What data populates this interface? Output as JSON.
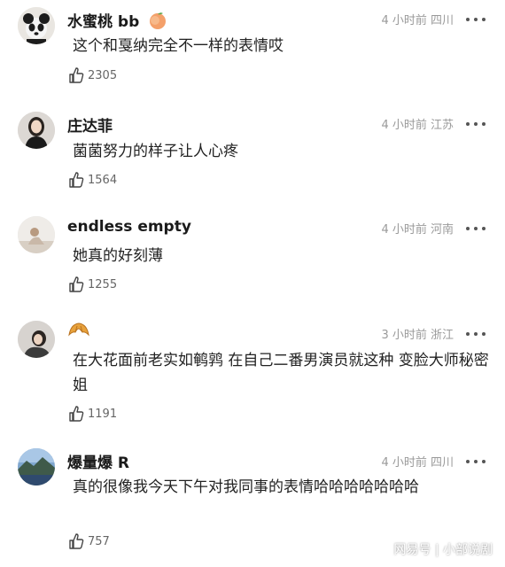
{
  "comments": [
    {
      "username": "水蜜桃 bb",
      "badge_icon": "peach-icon",
      "meta": "4 小时前  四川",
      "text": "这个和戛纳完全不一样的表情哎",
      "likes": "2305"
    },
    {
      "username": "庄达菲",
      "meta": "4 小时前  江苏",
      "text": "菌菌努力的样子让人心疼",
      "likes": "1564"
    },
    {
      "username": "endless empty",
      "meta": "4 小时前  河南",
      "text": "她真的好刻薄",
      "likes": "1255"
    },
    {
      "username": "",
      "badge_icon": "croissant-icon",
      "meta": "3 小时前  浙江",
      "text": "在大花面前老实如鹌鹑 在自己二番男演员就这种 变脸大师秘密姐",
      "likes": "1191"
    },
    {
      "username": "爆量爆 R",
      "meta": "4 小时前  四川",
      "text": "真的很像我今天下午对我同事的表情哈哈哈哈哈哈哈",
      "likes": "757"
    }
  ],
  "watermark": "网易号 | 小部说剧",
  "colors": {
    "meta": "#9a9a9a",
    "peach": "#f4a06a",
    "croissant": "#e8a23c"
  }
}
